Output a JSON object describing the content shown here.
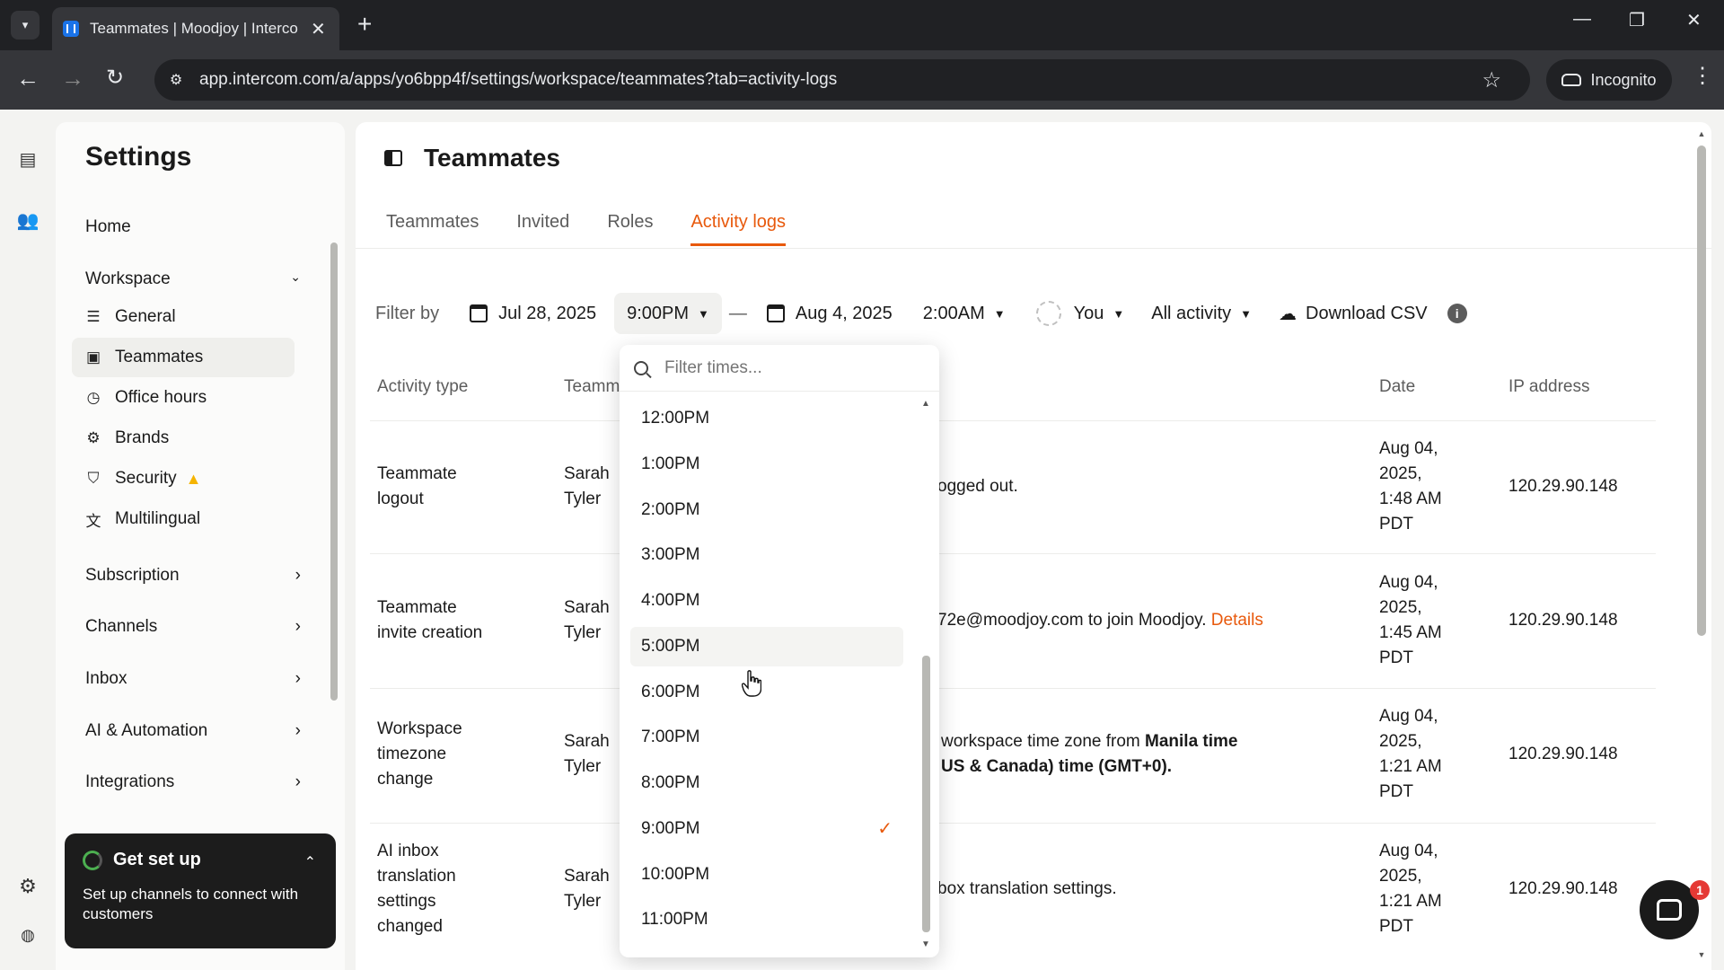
{
  "browser": {
    "tab_title": "Teammates | Moodjoy | Interco",
    "url": "app.intercom.com/a/apps/yo6bpp4f/settings/workspace/teammates?tab=activity-logs",
    "incognito_label": "Incognito"
  },
  "sidebar": {
    "title": "Settings",
    "home": "Home",
    "workspace": {
      "label": "Workspace",
      "items": [
        {
          "label": "General",
          "icon": "list-icon"
        },
        {
          "label": "Teammates",
          "icon": "id-badge-icon"
        },
        {
          "label": "Office hours",
          "icon": "clock-icon"
        },
        {
          "label": "Brands",
          "icon": "shapes-icon"
        },
        {
          "label": "Security",
          "icon": "shield-check-icon"
        },
        {
          "label": "Multilingual",
          "icon": "translate-icon"
        }
      ]
    },
    "sections": [
      "Subscription",
      "Channels",
      "Inbox",
      "AI & Automation",
      "Integrations"
    ]
  },
  "get_set_up": {
    "title": "Get set up",
    "body": "Set up channels to connect with customers"
  },
  "page": {
    "title": "Teammates",
    "tabs": [
      "Teammates",
      "Invited",
      "Roles",
      "Activity logs"
    ],
    "active_tab": "Activity logs"
  },
  "filters": {
    "label": "Filter by",
    "start_date": "Jul 28, 2025",
    "start_time": "9:00PM",
    "end_date": "Aug 4, 2025",
    "end_time": "2:00AM",
    "teammate": "You",
    "activity": "All activity",
    "download": "Download CSV"
  },
  "table": {
    "headers": {
      "activity_type": "Activity type",
      "teammate": "Teamm",
      "date": "Date",
      "ip": "IP address"
    },
    "rows": [
      {
        "type_l1": "Teammate",
        "type_l2": "logout",
        "type_l3": "",
        "who_l1": "Sarah",
        "who_l2": "Tyler",
        "desc_l1": "ogged out.",
        "desc_l2": "",
        "date_l1": "Aug 04,",
        "date_l2": "2025,",
        "date_l3": "1:48 AM",
        "date_l4": "PDT",
        "ip": "120.29.90.148"
      },
      {
        "type_l1": "Teammate",
        "type_l2": "invite creation",
        "type_l3": "",
        "who_l1": "Sarah",
        "who_l2": "Tyler",
        "desc_l1": "72e@moodjoy.com to join Moodjoy.",
        "desc_link": "Details",
        "date_l1": "Aug 04,",
        "date_l2": "2025,",
        "date_l3": "1:45 AM",
        "date_l4": "PDT",
        "ip": "120.29.90.148"
      },
      {
        "type_l1": "Workspace",
        "type_l2": "timezone",
        "type_l3": "change",
        "who_l1": "Sarah",
        "who_l2": "Tyler",
        "desc_l1a": "workspace time zone from ",
        "desc_l1b": "Manila time",
        "desc_l2": "US & Canada) time (GMT+0).",
        "date_l1": "Aug 04,",
        "date_l2": "2025,",
        "date_l3": "1:21 AM",
        "date_l4": "PDT",
        "ip": "120.29.90.148"
      },
      {
        "type_l1": "AI inbox",
        "type_l2": "translation",
        "type_l3": "settings",
        "type_l4": "changed",
        "who_l1": "Sarah",
        "who_l2": "Tyler",
        "desc_l1": "box translation settings.",
        "date_l1": "Aug 04,",
        "date_l2": "2025,",
        "date_l3": "1:21 AM",
        "date_l4": "PDT",
        "ip": "120.29.90.148"
      }
    ]
  },
  "time_dropdown": {
    "placeholder": "Filter times...",
    "options": [
      "12:00PM",
      "1:00PM",
      "2:00PM",
      "3:00PM",
      "4:00PM",
      "5:00PM",
      "6:00PM",
      "7:00PM",
      "8:00PM",
      "9:00PM",
      "10:00PM",
      "11:00PM"
    ],
    "selected": "9:00PM"
  },
  "messenger": {
    "badge": "1"
  },
  "colors": {
    "accent": "#e8590c",
    "warning": "#f5b400",
    "badge": "#e53935"
  }
}
